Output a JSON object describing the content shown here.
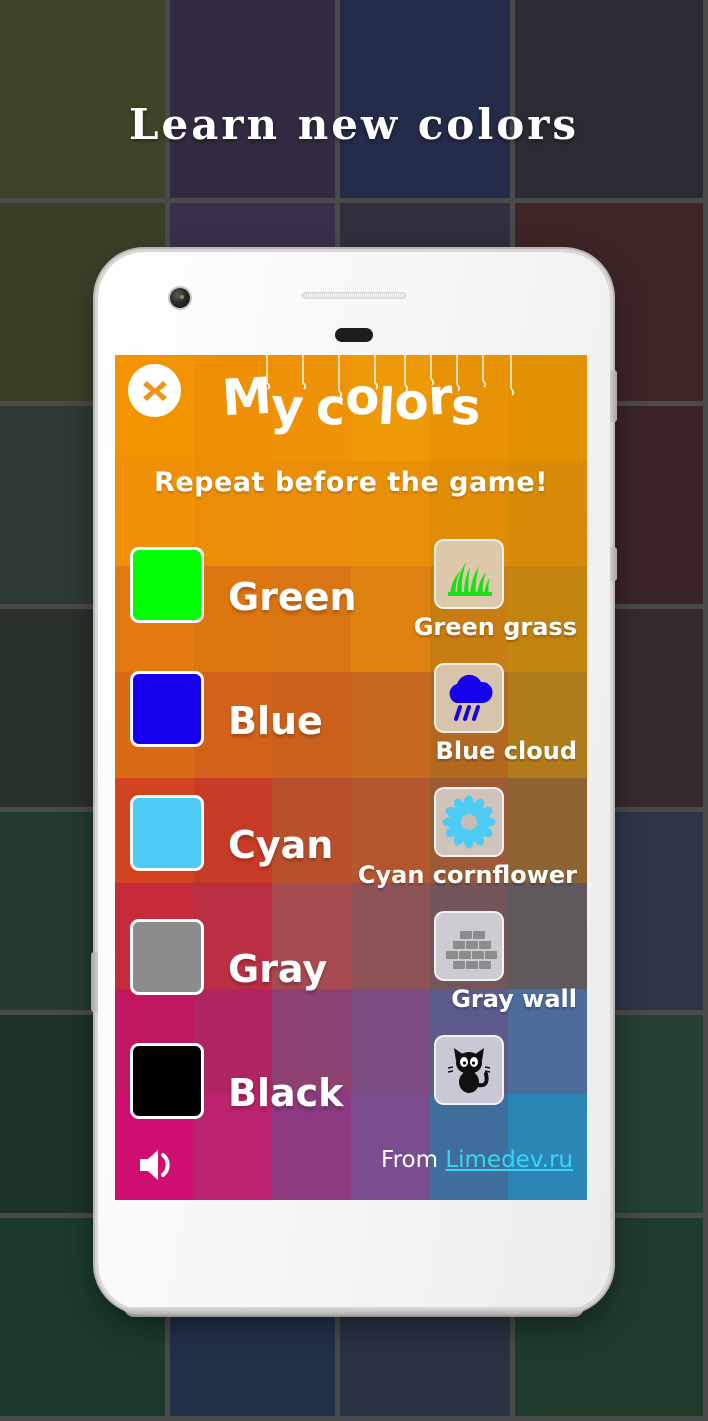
{
  "page": {
    "title": "Learn new colors",
    "background_grid_colors": [
      [
        "#3f4428",
        "#332b42",
        "#252c49",
        "#2c2a33"
      ],
      [
        "#3b3f27",
        "#3a2f4a",
        "#2f2f3d",
        "#3d2526"
      ],
      [
        "#2e3a33",
        "#2d2b3f",
        "#252845",
        "#3a2427"
      ],
      [
        "#29312b",
        "#272340",
        "#2b3147",
        "#352a2e"
      ],
      [
        "#243a2f",
        "#1f2a3f",
        "#2e2b3a",
        "#2d3546"
      ],
      [
        "#1e3328",
        "#233049",
        "#303046",
        "#244032"
      ],
      [
        "#1c3a2b",
        "#22304a",
        "#2b3243",
        "#1f3b2c"
      ]
    ],
    "grid_line_color": "#4a4a4a"
  },
  "phone": {
    "body_color": "#f5f5f5",
    "camera": "front-camera",
    "earpiece": "earpiece-speaker",
    "sensor": "proximity-sensor"
  },
  "app": {
    "title": "My colors",
    "title_chars": [
      "M",
      "y",
      " ",
      "c",
      "o",
      "l",
      "o",
      "r",
      "s"
    ],
    "subtitle": "Repeat before the game!",
    "close_label": "✕",
    "header_color": "#ef9516",
    "screen_grid": [
      [
        "#f29400",
        "#ef9004",
        "#ef9207",
        "#ee9a07",
        "#e89206",
        "#e29100"
      ],
      [
        "#ef9007",
        "#eb8e06",
        "#e98d0a",
        "#e89007",
        "#e08c07",
        "#d78b06"
      ],
      [
        "#e37a10",
        "#dd7610",
        "#d97512",
        "#de8310",
        "#c77d12",
        "#c2840f"
      ],
      [
        "#d96b14",
        "#d2621a",
        "#cc611e",
        "#c6691f",
        "#b2681f",
        "#b07c1a"
      ],
      [
        "#d2431f",
        "#c83b26",
        "#b9502c",
        "#b4572e",
        "#9c5b36",
        "#8c6331"
      ],
      [
        "#c62b3b",
        "#bb2f44",
        "#a74a52",
        "#8e5356",
        "#73555a",
        "#5f585c"
      ],
      [
        "#c01760",
        "#b02463",
        "#8e4272",
        "#7b4d80",
        "#5c5c8c",
        "#4d6c99"
      ],
      [
        "#ce0e70",
        "#bb2270",
        "#8c3a82",
        "#7a4d91",
        "#3f6e9c",
        "#2c86b5"
      ]
    ],
    "rows": [
      {
        "name": "Green",
        "swatch": "#00ff00",
        "icon": "grass-icon",
        "icon_bg": "#ddc8ab",
        "icon_color": "#19e016",
        "desc": "Green grass"
      },
      {
        "name": "Blue",
        "swatch": "#1500ec",
        "icon": "rain-cloud-icon",
        "icon_bg": "#d7c4ac",
        "icon_color": "#1500ec",
        "desc": "Blue cloud"
      },
      {
        "name": "Cyan",
        "swatch": "#4ecbf5",
        "icon": "cornflower-icon",
        "icon_bg": "#cfc3bb",
        "icon_color": "#4ecbf5",
        "desc": "Cyan cornflower"
      },
      {
        "name": "Gray",
        "swatch": "#8c8c8c",
        "icon": "brick-wall-icon",
        "icon_bg": "#cdcad2",
        "icon_color": "#8c8c8c",
        "desc": "Gray wall"
      },
      {
        "name": "Black",
        "swatch": "#000000",
        "icon": "black-cat-icon",
        "icon_bg": "#c9c9d6",
        "icon_color": "#111111",
        "desc": ""
      }
    ],
    "footer": {
      "sound_icon": "speaker-on-icon",
      "from_prefix": "From ",
      "link_text": "Limedev.ru",
      "link_color": "#37d7f2"
    }
  }
}
